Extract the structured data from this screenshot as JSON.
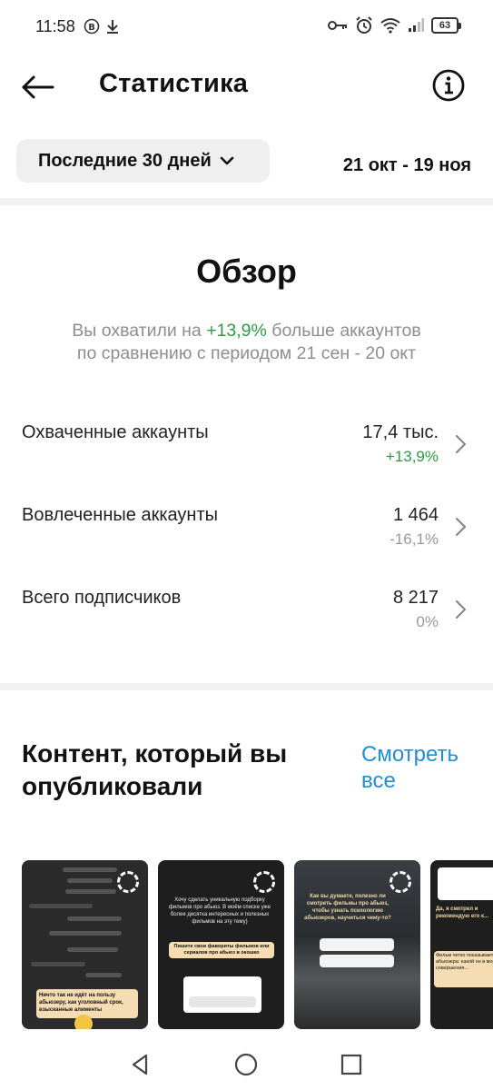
{
  "status_bar": {
    "time": "11:58",
    "battery": "63",
    "icons": [
      "b-coin-icon",
      "download-icon",
      "key-icon",
      "alarm-icon",
      "wifi-icon",
      "signal-icon",
      "battery-icon"
    ]
  },
  "header": {
    "title": "Статистика",
    "back_icon": "arrow-left-icon",
    "info_icon": "info-icon"
  },
  "range": {
    "selected": "Последние 30 дней",
    "dates": "21 окт - 19 ноя"
  },
  "overview": {
    "title": "Обзор",
    "sub_prefix": "Вы охватили на ",
    "sub_delta": "+13,9%",
    "sub_suffix": " больше аккаунтов",
    "sub_line2": "по сравнению с периодом 21 сен - 20 окт",
    "metrics": [
      {
        "label": "Охваченные аккаунты",
        "value": "17,4 тыс.",
        "delta": "+13,9%"
      },
      {
        "label": "Вовлеченные аккаунты",
        "value": "1 464",
        "delta": "-16,1%"
      },
      {
        "label": "Всего подписчиков",
        "value": "8 217",
        "delta": "0%"
      }
    ]
  },
  "content": {
    "title": "Контент, который вы опубликовали",
    "see_all": "Смотреть все",
    "thumbnails": [
      {
        "texts": [
          "Ничто так не идёт на пользу абьюзеру, как уголовный срок, взысканные алименты"
        ]
      },
      {
        "texts": [
          "Хочу сделать уникальную подборку фильмов про абьюз. В моём списке уже более десятка интересных и полезных фильмов на эту тему)",
          "Пишите свои фавориты фильмов или сериалов про абьюз в окошко"
        ]
      },
      {
        "texts": [
          "Как вы думаете, полезно ли смотреть фильмы про абьюз, чтобы узнать психологию абьюзеров, научиться чему-то?"
        ]
      },
      {
        "texts": [
          "Да, я смотрел и рекомендую его к...",
          "Фильм четко показывает абьюзера: какой он в момент совершения..."
        ]
      }
    ]
  },
  "colors": {
    "accent_link": "#1f8fd6",
    "positive": "#2e9a47",
    "muted": "#8e8e8e",
    "pill_bg": "#efefef"
  },
  "nav": {
    "back": "triangle-back-icon",
    "home": "circle-home-icon",
    "recents": "square-recents-icon"
  }
}
